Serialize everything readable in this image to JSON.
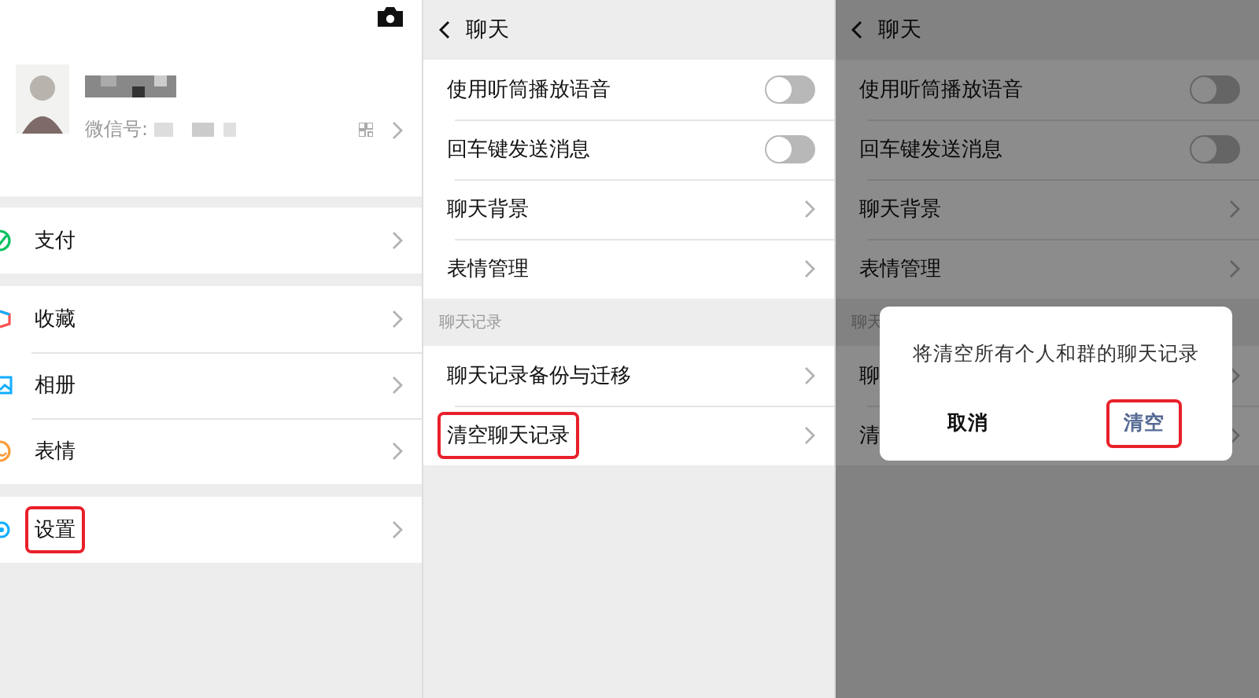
{
  "me_page": {
    "wechat_id_label": "微信号:",
    "groups": [
      [
        {
          "label": "支付",
          "kind": "pay",
          "highlighted": false
        }
      ],
      [
        {
          "label": "收藏",
          "kind": "favorites",
          "highlighted": false
        },
        {
          "label": "相册",
          "kind": "album",
          "highlighted": false
        },
        {
          "label": "表情",
          "kind": "sticker",
          "highlighted": false
        }
      ],
      [
        {
          "label": "设置",
          "kind": "settings",
          "highlighted": true
        }
      ]
    ]
  },
  "chat_settings": {
    "title": "聊天",
    "groups": [
      {
        "items": [
          {
            "label": "使用听筒播放语音",
            "kind": "toggle",
            "on": false,
            "highlighted": false
          },
          {
            "label": "回车键发送消息",
            "kind": "toggle",
            "on": false,
            "highlighted": false
          },
          {
            "label": "聊天背景",
            "kind": "link",
            "highlighted": false
          },
          {
            "label": "表情管理",
            "kind": "link",
            "highlighted": false
          }
        ]
      },
      {
        "header": "聊天记录",
        "items": [
          {
            "label": "聊天记录备份与迁移",
            "kind": "link",
            "highlighted": false
          },
          {
            "label": "清空聊天记录",
            "kind": "link",
            "highlighted": true
          }
        ]
      }
    ]
  },
  "confirm_screen": {
    "title": "聊天",
    "groups": [
      {
        "items": [
          {
            "label": "使用听筒播放语音",
            "kind": "toggle",
            "on": false,
            "highlighted": false
          },
          {
            "label": "回车键发送消息",
            "kind": "toggle",
            "on": false,
            "highlighted": false
          },
          {
            "label": "聊天背景",
            "kind": "link",
            "highlighted": false
          },
          {
            "label": "表情管理",
            "kind": "link",
            "highlighted": false
          }
        ]
      },
      {
        "header": "聊天",
        "items": [
          {
            "label": "聊",
            "kind": "link",
            "highlighted": false
          },
          {
            "label": "清",
            "kind": "link",
            "highlighted": false
          }
        ]
      }
    ],
    "dialog": {
      "message": "将清空所有个人和群的聊天记录",
      "buttons": [
        {
          "label": "取消",
          "kind": "default",
          "highlighted": false
        },
        {
          "label": "清空",
          "kind": "primary",
          "highlighted": true
        }
      ]
    }
  }
}
